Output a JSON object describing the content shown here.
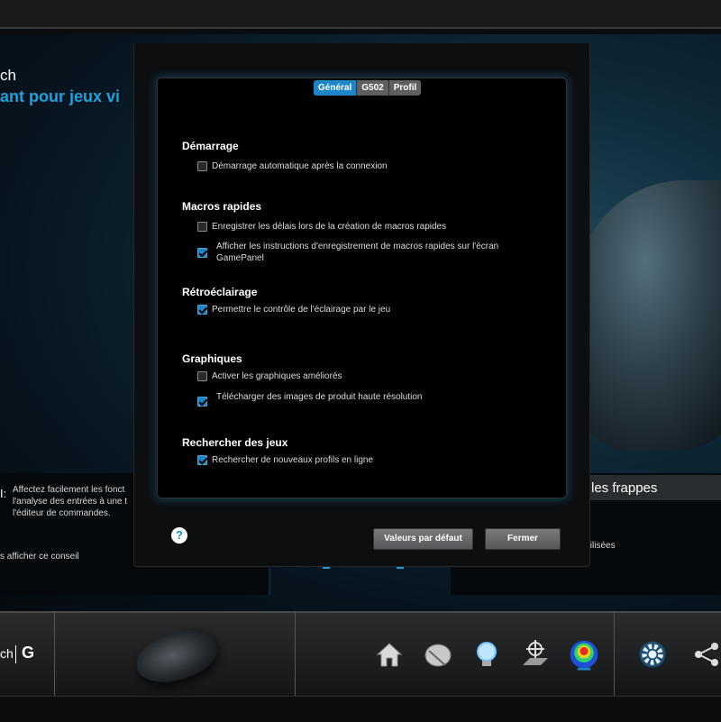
{
  "background": {
    "title_line1": "ch",
    "title_line2": "ant pour jeux vi",
    "tip_marker": "I:",
    "tip_text": "Affectez facilement les fonct l'analyse des entrées à une t l'éditeur de commandes.",
    "tip_hide": "s afficher ce conseil",
    "right_panel_title": "les frappes",
    "right_panel_text": "tilisées"
  },
  "bottom_bar": {
    "logo_text": "ch",
    "logo_g": "G",
    "nav_icons": [
      "home-icon",
      "mouse-customize-icon",
      "lighting-bulb-icon",
      "target-dpi-icon",
      "heatmap-icon",
      "settings-gear-icon",
      "share-icon"
    ]
  },
  "dialog": {
    "tabs": [
      {
        "label": "Général",
        "active": true
      },
      {
        "label": "G502",
        "active": false
      },
      {
        "label": "Profil",
        "active": false
      }
    ],
    "sections": {
      "startup": {
        "title": "Démarrage",
        "options": [
          {
            "label": "Démarrage automatique après la connexion",
            "checked": false
          }
        ]
      },
      "macros": {
        "title": "Macros rapides",
        "options": [
          {
            "label": "Enregistrer les délais lors de la création de macros rapides",
            "checked": false
          },
          {
            "label": "Afficher les instructions d'enregistrement de macros rapides sur l'écran GamePanel",
            "checked": true
          }
        ]
      },
      "backlight": {
        "title": "Rétroéclairage",
        "options": [
          {
            "label": "Permettre le contrôle de l'éclairage par le jeu",
            "checked": true
          }
        ]
      },
      "graphics": {
        "title": "Graphiques",
        "options": [
          {
            "label": "Activer les graphiques améliorés",
            "checked": false
          },
          {
            "label": "Télécharger des images de produit haute résolution",
            "checked": true
          }
        ]
      },
      "games": {
        "title": "Rechercher des jeux",
        "options": [
          {
            "label": "Rechercher de nouveaux profils en ligne",
            "checked": true
          }
        ]
      }
    },
    "help_symbol": "?",
    "defaults_button": "Valeurs par défaut",
    "close_button": "Fermer"
  }
}
